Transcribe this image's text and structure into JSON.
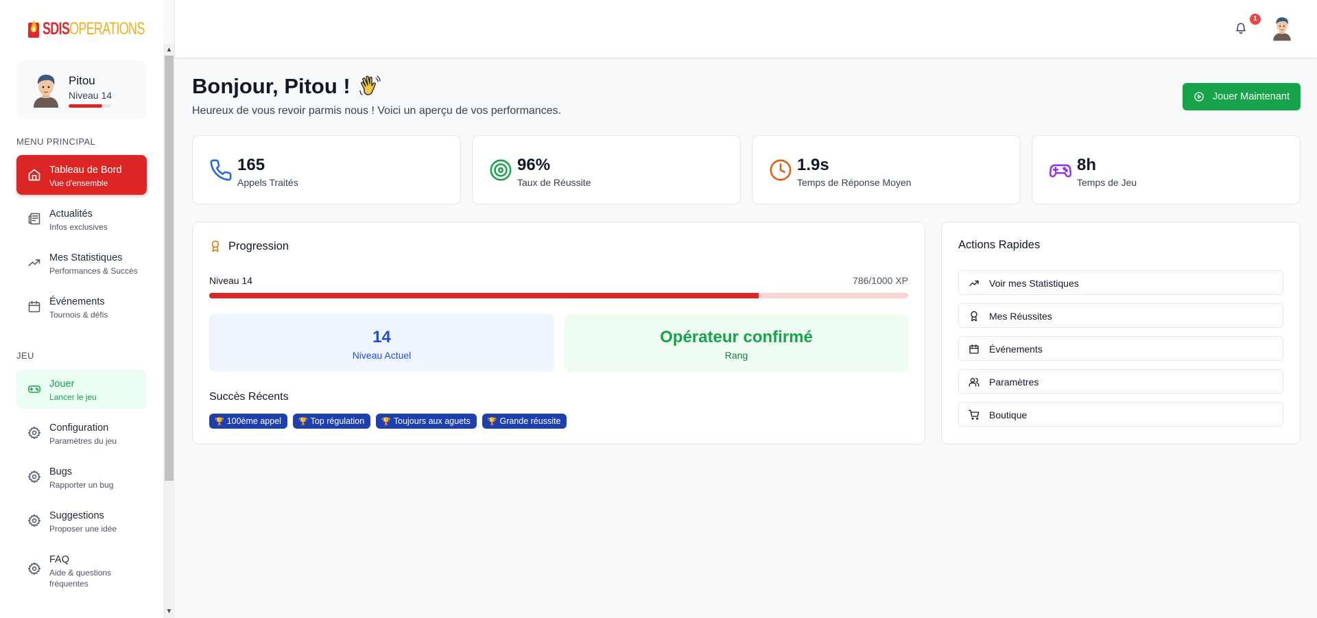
{
  "brand": {
    "part1": "SDIS",
    "part2": "OPERATIONS"
  },
  "user": {
    "name": "Pitou",
    "level": "Niveau 14",
    "progress_fraction": 0.786
  },
  "sidebar": {
    "main_label": "MENU PRINCIPAL",
    "game_label": "JEU",
    "items": [
      {
        "title": "Tableau de Bord",
        "sub": "Vue d'ensemble"
      },
      {
        "title": "Actualités",
        "sub": "Infos exclusives"
      },
      {
        "title": "Mes Statistiques",
        "sub": "Performances & Succès"
      },
      {
        "title": "Événements",
        "sub": "Tournois & défis"
      },
      {
        "title": "Jouer",
        "sub": "Lancer le jeu"
      },
      {
        "title": "Configuration",
        "sub": "Paramètres du jeu"
      },
      {
        "title": "Bugs",
        "sub": "Rapporter un bug"
      },
      {
        "title": "Suggestions",
        "sub": "Proposer une idée"
      },
      {
        "title": "FAQ",
        "sub": "Aide & questions fréquentes"
      }
    ]
  },
  "header": {
    "notification_count": "1"
  },
  "main": {
    "greeting": "Bonjour, Pitou !",
    "subtitle": "Heureux de vous revoir parmis nous ! Voici un aperçu de vos performances.",
    "play_button": "Jouer Maintenant",
    "stats": [
      {
        "value": "165",
        "label": "Appels Traités",
        "icon": "phone-icon",
        "color": "#2563eb"
      },
      {
        "value": "96%",
        "label": "Taux de Réussite",
        "icon": "target-icon",
        "color": "#16a34a"
      },
      {
        "value": "1.9s",
        "label": "Temps de Réponse Moyen",
        "icon": "clock-icon",
        "color": "#ea580c"
      },
      {
        "value": "8h",
        "label": "Temps de Jeu",
        "icon": "gamepad-icon",
        "color": "#9333ea"
      }
    ]
  },
  "progress": {
    "title": "Progression",
    "level_label": "Niveau 14",
    "xp_label": "786/1000 XP",
    "xp_fraction": 0.786,
    "level_value": "14",
    "level_caption": "Niveau Actuel",
    "rank_value": "Opérateur confirmé",
    "rank_caption": "Rang",
    "success_title": "Succès Récents",
    "achievements": [
      "100ème appel",
      "Top régulation",
      "Toujours aux aguets",
      "Grande réussite"
    ]
  },
  "quick_actions": {
    "title": "Actions Rapides",
    "items": [
      "Voir mes Statistiques",
      "Mes Réussites",
      "Événements",
      "Paramètres",
      "Boutique"
    ]
  },
  "colors": {
    "accent_red": "#dc2626",
    "accent_green": "#16a34a",
    "accent_blue": "#1d4ed8",
    "chip_blue": "#1e40af"
  }
}
